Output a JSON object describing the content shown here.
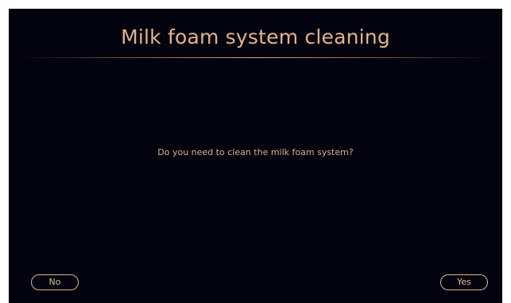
{
  "dialog": {
    "title": "Milk foam system cleaning",
    "message": "Do you need to clean the milk foam system?",
    "no_label": "No",
    "yes_label": "Yes"
  },
  "colors": {
    "background": "#03030f",
    "accent": "#e2b48a"
  }
}
